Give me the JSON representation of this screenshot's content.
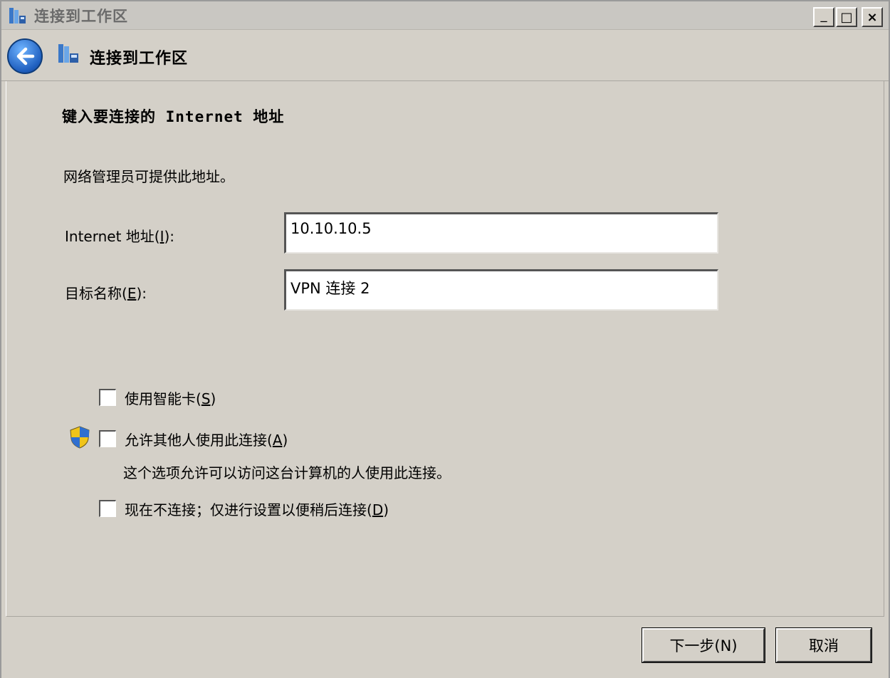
{
  "window": {
    "title": "连接到工作区",
    "minimize_glyph": "_",
    "maximize_glyph": "□",
    "close_glyph": "×"
  },
  "header": {
    "title": "连接到工作区"
  },
  "main": {
    "heading": "键入要连接的 Internet 地址",
    "description": "网络管理员可提供此地址。",
    "internet_address": {
      "label_prefix": "Internet 地址(",
      "label_key": "I",
      "label_suffix": "):",
      "value": "10.10.10.5"
    },
    "destination_name": {
      "label_prefix": "目标名称(",
      "label_key": "E",
      "label_suffix": "):",
      "value": "VPN 连接 2"
    },
    "options": {
      "smart_card": {
        "label_prefix": "使用智能卡(",
        "key": "S",
        "label_suffix": ")",
        "checked": false
      },
      "allow_others": {
        "label_prefix": "允许其他人使用此连接(",
        "key": "A",
        "label_suffix": ")",
        "checked": false,
        "description": "这个选项允许可以访问这台计算机的人使用此连接。"
      },
      "dont_connect": {
        "label_prefix": "现在不连接；仅进行设置以便稍后连接(",
        "key": "D",
        "label_suffix": ")",
        "checked": false
      }
    }
  },
  "footer": {
    "next_label": "下一步(N)",
    "cancel_label": "取消"
  },
  "colors": {
    "window_bg": "#d4d0c8",
    "back_button": "#1f5fbf",
    "input_bg": "#ffffff"
  },
  "icons": {
    "title": "network-workplace-icon",
    "back": "back-arrow-icon",
    "header": "network-workplace-icon",
    "uac": "uac-shield-icon"
  }
}
